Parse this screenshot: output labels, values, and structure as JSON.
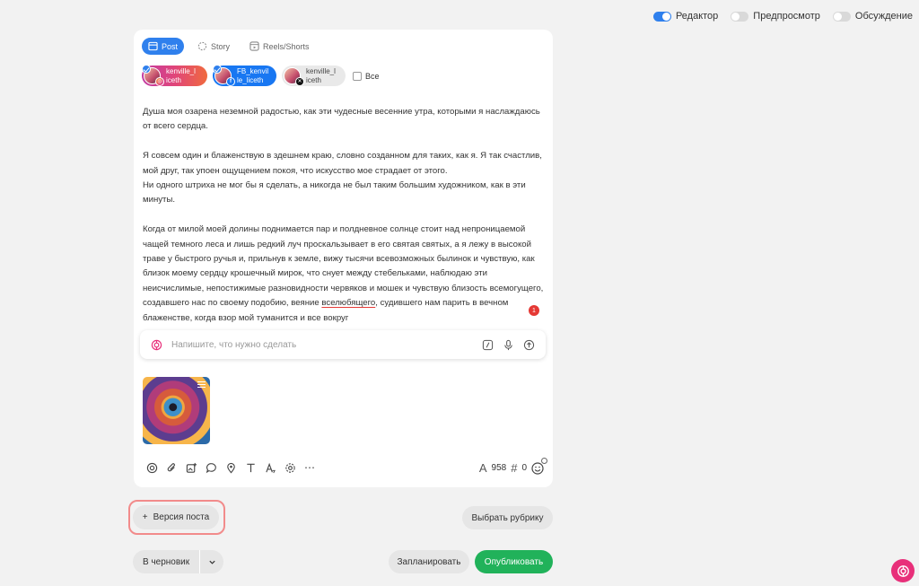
{
  "modes": [
    {
      "label": "Редактор",
      "on": true
    },
    {
      "label": "Предпросмотр",
      "on": false
    },
    {
      "label": "Обсуждение",
      "on": false
    }
  ],
  "tabs": {
    "post": "Post",
    "story": "Story",
    "reels": "Reels/Shorts"
  },
  "accounts": {
    "instagram": {
      "line1": "kenville_l",
      "line2": "iceth",
      "network_icon": "instagram-icon"
    },
    "facebook": {
      "line1": "FB_kenvil",
      "line2": "le_liceth",
      "network_icon": "facebook-icon"
    },
    "x": {
      "line1": "kenville_l",
      "line2": "iceth",
      "network_icon": "x-icon"
    },
    "all_label": "Все"
  },
  "post": {
    "p1": "Душа моя озарена неземной радостью, как эти чудесные весенние утра, которыми я наслаждаюсь от всего сердца.",
    "p2a": "Я совсем один и блаженствую в здешнем краю, словно созданном для таких, как я. Я так счастлив, мой друг, так упоен ощущением покоя, что искусство мое страдает от этого.",
    "p2b": "Ни одного штриха не мог бы я сделать, а никогда не был таким большим художником, как в эти минуты.",
    "p3_before": "Когда от милой моей долины поднимается пар и полдневное солнце стоит над непроницаемой чащей темного леса и лишь редкий луч проскальзывает в его святая святых, а я лежу в высокой траве у быстрого ручья и, прильнув к земле, вижу тысячи всевозможных былинок и чувствую, как близок моему сердцу крошечный мирок, что снует между стебельками, наблюдаю эти неисчислимые, непостижимые разновидности червяков и мошек и чувствую близость всемогущего, создавшего нас по своему подобию, веяние ",
    "p3_misspelled": "вселюбящего",
    "p3_after": ", судившего нам парить в вечном блаженстве, когда взор мой туманится и все вокруг",
    "spell_errors": "1"
  },
  "ai_prompt": {
    "placeholder": "Напишите, что нужно сделать"
  },
  "stats": {
    "chars": "958",
    "hashtags": "0"
  },
  "buttons": {
    "version": "Версия поста",
    "rubric": "Выбрать рубрику",
    "draft": "В черновик",
    "schedule": "Запланировать",
    "publish": "Опубликовать"
  },
  "colors": {
    "accent": "#2f80ed",
    "publish": "#21b25a",
    "highlight": "#f28b8b",
    "error": "#e53935",
    "fab": "#e8307a"
  }
}
